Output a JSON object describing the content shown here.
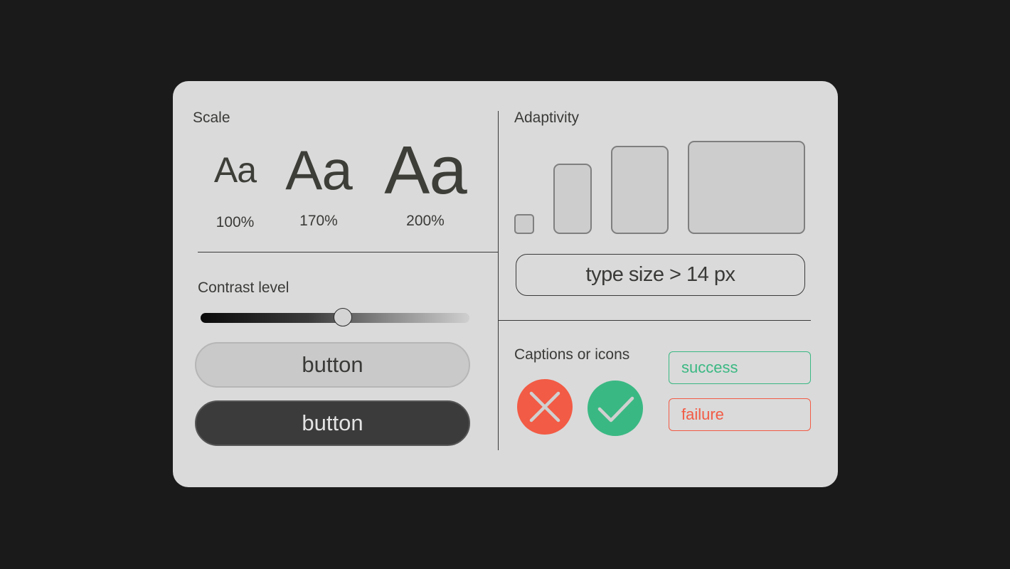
{
  "scale": {
    "title": "Scale",
    "sample_text": "Aa",
    "levels": [
      "100%",
      "170%",
      "200%"
    ]
  },
  "adaptivity": {
    "title": "Adaptivity",
    "rule": "type size > 14 px"
  },
  "contrast": {
    "title": "Contrast level",
    "value_fraction": 0.53
  },
  "buttons": {
    "light_label": "button",
    "dark_label": "button"
  },
  "captions": {
    "title": "Captions or icons",
    "success_label": "success",
    "failure_label": "failure"
  },
  "icons": {
    "failure": "close-icon",
    "success": "check-icon"
  },
  "colors": {
    "success": "#3ab883",
    "failure": "#f25b45",
    "background": "#1a1a1a",
    "card": "#dadada"
  }
}
